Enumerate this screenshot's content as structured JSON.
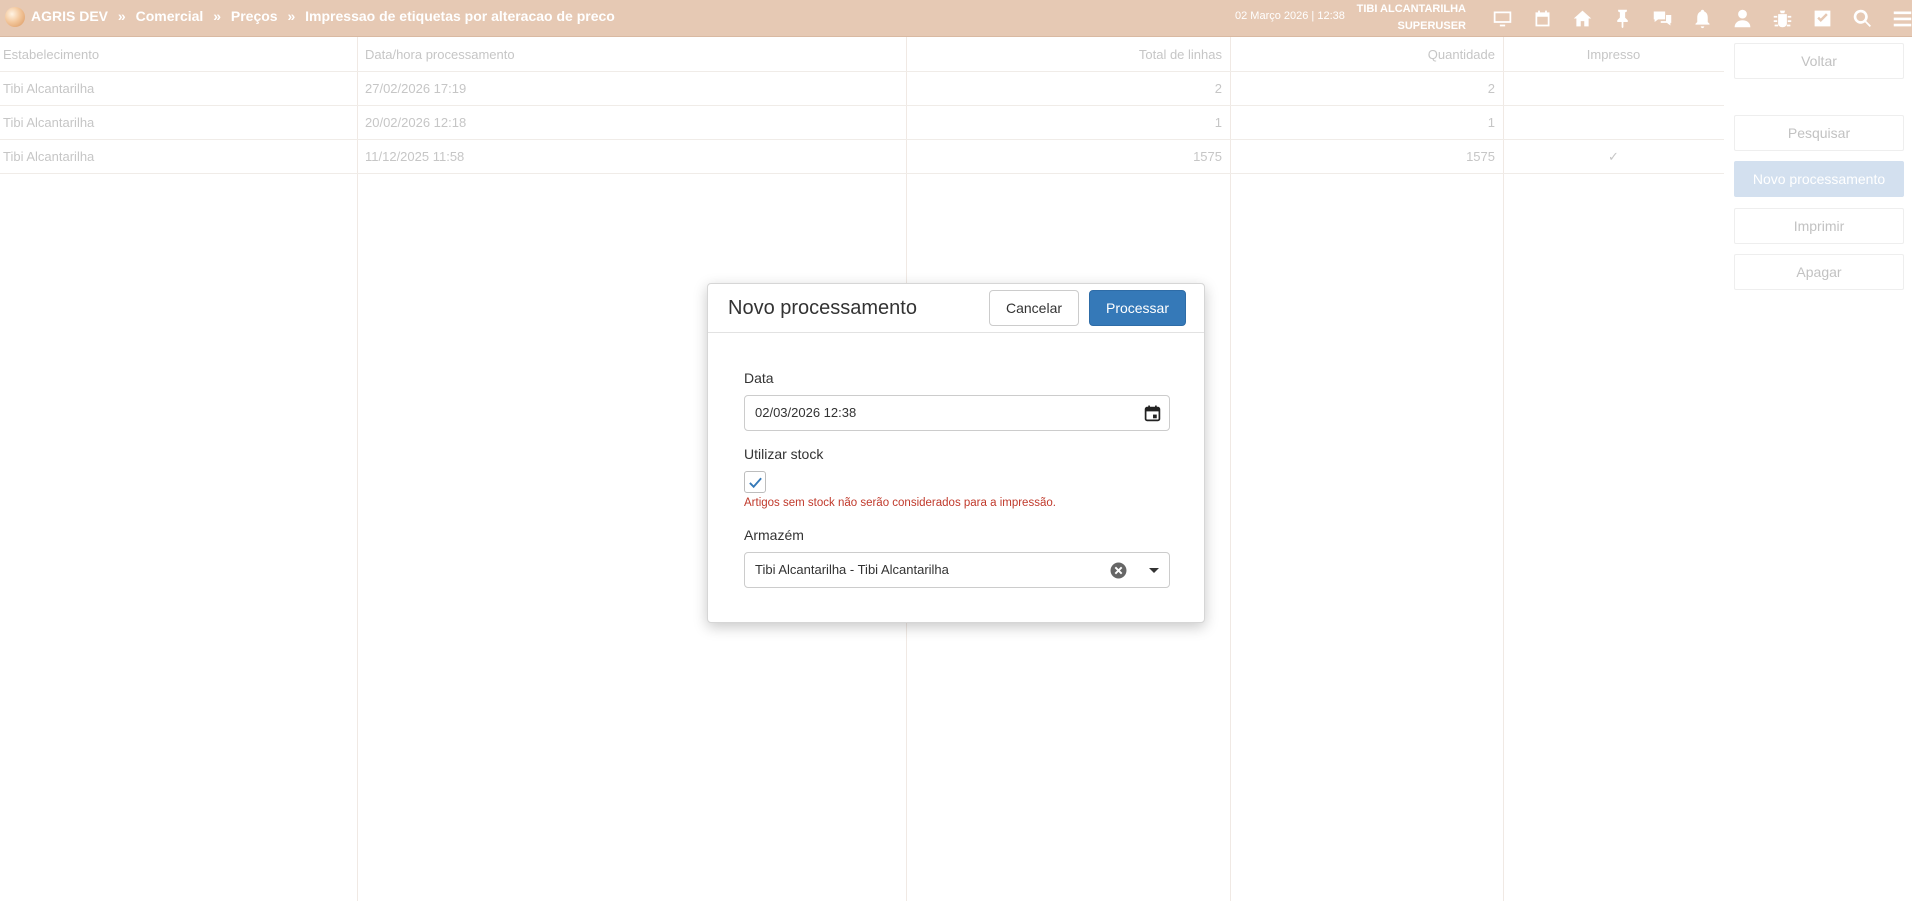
{
  "topbar": {
    "breadcrumb": [
      "AGRIS DEV",
      "Comercial",
      "Preços",
      "Impressao de etiquetas por alteracao de preco"
    ],
    "separator": "»",
    "date_time": "02 Março 2026 | 12:38",
    "user_name": "TIBI ALCANTARILHA",
    "user_role": "SUPERUSER",
    "icons": [
      "monitor-icon",
      "calendar-icon",
      "home-icon",
      "pin-icon",
      "chat-icon",
      "bell-icon",
      "user-icon",
      "bug-icon",
      "task-check-icon",
      "search-icon",
      "menu-icon"
    ]
  },
  "table": {
    "columns": [
      "Estabelecimento",
      "Data/hora processamento",
      "Total de linhas",
      "Quantidade",
      "Impresso"
    ],
    "rows": [
      {
        "estabelecimento": "Tibi Alcantarilha",
        "data": "27/02/2026 17:19",
        "total": "2",
        "quantidade": "2",
        "impresso": false
      },
      {
        "estabelecimento": "Tibi Alcantarilha",
        "data": "20/02/2026 12:18",
        "total": "1",
        "quantidade": "1",
        "impresso": false
      },
      {
        "estabelecimento": "Tibi Alcantarilha",
        "data": "11/12/2025 11:58",
        "total": "1575",
        "quantidade": "1575",
        "impresso": true
      }
    ],
    "check_glyph": "✓"
  },
  "actions": {
    "voltar": "Voltar",
    "pesquisar": "Pesquisar",
    "novo": "Novo processamento",
    "imprimir": "Imprimir",
    "apagar": "Apagar"
  },
  "modal": {
    "title": "Novo processamento",
    "cancel_label": "Cancelar",
    "submit_label": "Processar",
    "data_label": "Data",
    "data_value": "02/03/2026 12:38",
    "stock_label": "Utilizar stock",
    "stock_checked": true,
    "stock_help": "Artigos sem stock não serão considerados para a impressão.",
    "armazem_label": "Armazém",
    "armazem_value": "Tibi Alcantarilha - Tibi Alcantarilha"
  },
  "colors": {
    "topbar": "#e6c9b4",
    "primary": "#3579b8",
    "error": "#c0392b"
  }
}
